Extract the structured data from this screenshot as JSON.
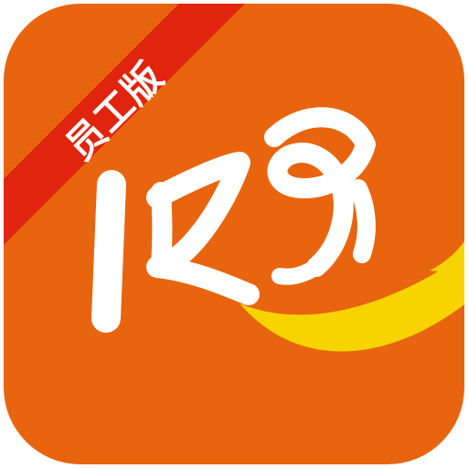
{
  "icon": {
    "ribbon_label": "员工版",
    "mark_name": "brush-script-logo",
    "colors": {
      "background": "#E8640F",
      "ribbon": "#E0240E",
      "swoosh": "#F7D400",
      "mark": "#FFFFFF"
    }
  }
}
